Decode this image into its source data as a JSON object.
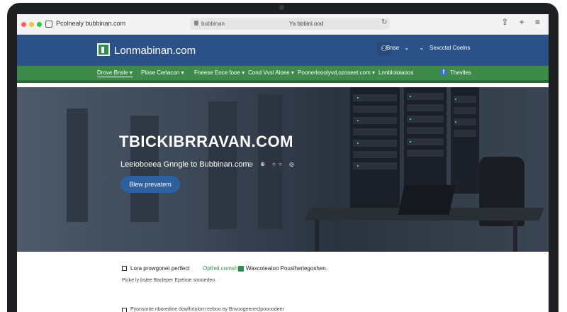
{
  "browser": {
    "tab_title": "Pcolnealy bubbinan.com",
    "address_site": "bubbinan",
    "address_center": "Ya bbbinl.ood",
    "reload_icon": "reload-icon",
    "toolbar_icons": "⇪ + ≡",
    "traffic_light_colors": [
      "#ff5f57",
      "#febc2e",
      "#28c840"
    ]
  },
  "header": {
    "logo_text": "Lonmabinan.com",
    "search_label": "Bnse",
    "arrow": "⌄",
    "arrow2": "⌄",
    "contact_label": "Sexcctal Coelns",
    "bg_color": "#2c5186"
  },
  "nav": {
    "items": [
      {
        "label": "Drove Bnsle ▾"
      },
      {
        "label": "Plose Cerlacon ▾"
      },
      {
        "label": "Fneese Eoce fooe ▾"
      },
      {
        "label": "Cond Vvsl Aloee ▾"
      },
      {
        "label": "Poonerleoolyvd,ozoseet.com ▾"
      },
      {
        "label": "Lnnbloioiaoos"
      },
      {
        "label": "Thevlles"
      }
    ],
    "bg_color": "#3e8a4a"
  },
  "hero": {
    "title": "TBICKIBRRAVAN.COM",
    "subtitle": "Leeioboeea Gnngle to Bubbinan.com",
    "social": "◎ ⊕ ○○ ◎",
    "cta_label": "Blew prevatem"
  },
  "content": {
    "line1_a": "Lora prowgonet perllect",
    "line1_b": "Opthel.comsh",
    "line1_c": "Waxcoteatoo Pouslheriegoshen.",
    "line2": "Picke ly bslee Bacleper Epelroe snooedeo.",
    "line3": "Pyonsonte nboredine dowlhrtolorn eeboo ey Bnvoogeeneclpoonodeer"
  }
}
